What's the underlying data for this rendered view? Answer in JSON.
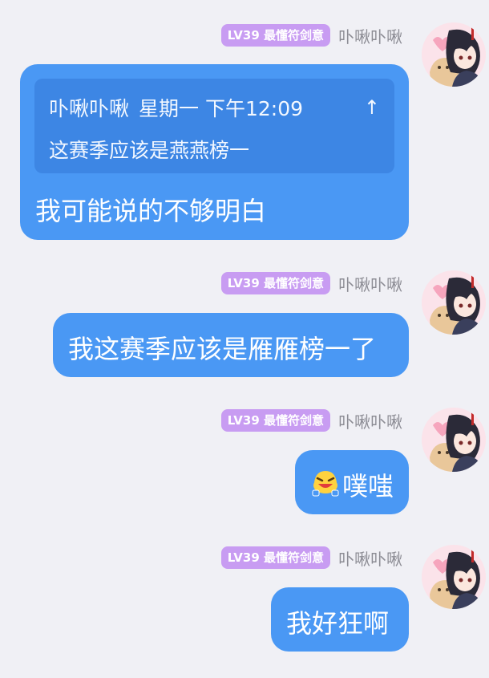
{
  "messages": [
    {
      "badge": "LV39 最懂符剑意",
      "sender": "卟啾卟啾",
      "quote": {
        "name": "卟啾卟啾",
        "time": "星期一 下午12:09",
        "jump_icon": "↑",
        "text": "这赛季应该是燕燕榜一"
      },
      "text": "我可能说的不够明白"
    },
    {
      "badge": "LV39 最懂符剑意",
      "sender": "卟啾卟啾",
      "text": "我这赛季应该是雁雁榜一了"
    },
    {
      "badge": "LV39 最懂符剑意",
      "sender": "卟啾卟啾",
      "emoji": "laughing-face-emoji",
      "text": "噗嗤"
    },
    {
      "badge": "LV39 最懂符剑意",
      "sender": "卟啾卟啾",
      "text": "我好狂啊"
    }
  ],
  "colors": {
    "background": "#f0f0f5",
    "bubble": "#4a98f4",
    "quote_bg": "#3d86e4",
    "badge": "#c89cf2",
    "sender_text": "#8c8c94"
  }
}
